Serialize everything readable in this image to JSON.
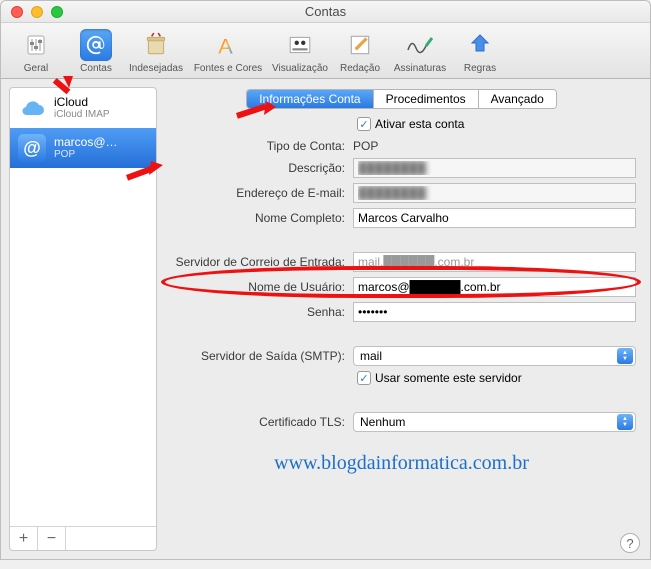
{
  "window": {
    "title": "Contas"
  },
  "toolbar": [
    {
      "id": "geral",
      "label": "Geral",
      "icon": "slider-icon"
    },
    {
      "id": "contas",
      "label": "Contas",
      "icon": "at-icon",
      "selected": true
    },
    {
      "id": "indesejadas",
      "label": "Indesejadas",
      "icon": "trash-icon"
    },
    {
      "id": "fontes",
      "label": "Fontes e Cores",
      "icon": "font-icon"
    },
    {
      "id": "visualizacao",
      "label": "Visualização",
      "icon": "photo-icon"
    },
    {
      "id": "redacao",
      "label": "Redação",
      "icon": "compose-icon"
    },
    {
      "id": "assinaturas",
      "label": "Assinaturas",
      "icon": "signature-icon"
    },
    {
      "id": "regras",
      "label": "Regras",
      "icon": "rules-icon"
    }
  ],
  "accounts": [
    {
      "name": "iCloud",
      "sub": "iCloud IMAP",
      "icon": "cloud",
      "selected": false
    },
    {
      "name": "marcos@…",
      "sub": "POP",
      "icon": "at",
      "selected": true
    }
  ],
  "sidebar_footer": {
    "add": "+",
    "remove": "−"
  },
  "tabs": [
    {
      "label": "Informações Conta",
      "active": true
    },
    {
      "label": "Procedimentos",
      "active": false
    },
    {
      "label": "Avançado",
      "active": false
    }
  ],
  "form": {
    "activate_label": "Ativar esta conta",
    "activate_checked": true,
    "type_label": "Tipo de Conta:",
    "type_value": "POP",
    "desc_label": "Descrição:",
    "desc_value": "████████",
    "email_label": "Endereço de E-mail:",
    "email_value": "████████",
    "fullname_label": "Nome Completo:",
    "fullname_value": "Marcos Carvalho",
    "incoming_label": "Servidor de Correio de Entrada:",
    "incoming_value": "mail.██████.com.br",
    "user_label": "Nome de Usuário:",
    "user_value": "marcos@██████.com.br",
    "pass_label": "Senha:",
    "pass_value": "•••••••",
    "smtp_label": "Servidor de Saída (SMTP):",
    "smtp_value": "mail",
    "smtp_only_label": "Usar somente este servidor",
    "smtp_only_checked": true,
    "tls_label": "Certificado TLS:",
    "tls_value": "Nenhum"
  },
  "watermark": "www.blogdainformatica.com.br",
  "help": "?"
}
